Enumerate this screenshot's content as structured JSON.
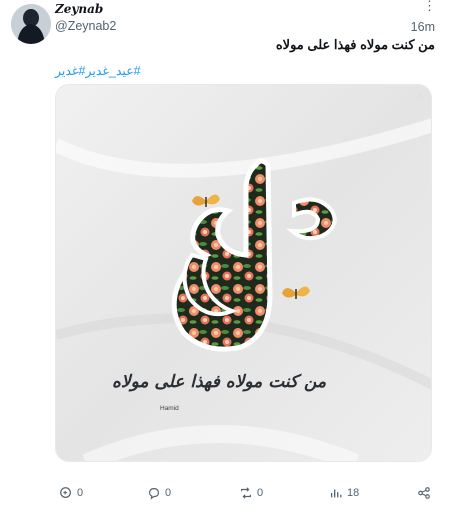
{
  "author": {
    "display_name": "Zeynab",
    "handle": "@Zeynab2"
  },
  "timestamp": "16m",
  "more_icon": "⋮",
  "tweet_text": "من كنت مولاه فهذا علی مولاه",
  "hashtags": [
    "#غدیر",
    "#عید_غدیر"
  ],
  "media": {
    "calligraphy_word": "علی",
    "caption": "من کنت مولاه فهذا علی مولاه",
    "signature": "Hamid"
  },
  "actions": {
    "replies": "0",
    "comments": "0",
    "retweets": "0",
    "views": "18"
  },
  "colors": {
    "link": "#1d9bf0",
    "muted": "#536471"
  }
}
